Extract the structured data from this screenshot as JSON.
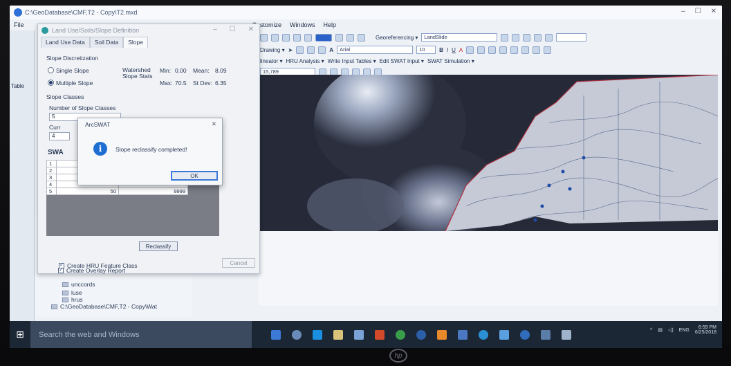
{
  "window": {
    "title": "C:\\GeoDatabase\\CMF,T2 - Copy\\T2.mxd"
  },
  "menubar": {
    "items": [
      "File",
      "Customize",
      "Windows",
      "Help"
    ]
  },
  "toolbar": {
    "georeferencing": "Georeferencing ▾",
    "layer": "LandSlide",
    "drawing": "Drawing ▾",
    "font": "Arial",
    "font_size": "10",
    "swat_items": [
      "lineator ▾",
      "HRU Analysis ▾",
      "Write Input Tables ▾",
      "Edit SWAT Input ▾",
      "SWAT Simulation ▾"
    ],
    "scale": "15,789"
  },
  "dialog": {
    "title": "Land Use/Soils/Slope Definition",
    "tabs": [
      "Land Use Data",
      "Soil Data",
      "Slope"
    ],
    "active_tab": "Slope",
    "slope_discretization": {
      "label": "Slope Discretization",
      "single": "Single Slope",
      "multiple": "Multiple Slope",
      "watershed_stats": "Watershed Slope Stats",
      "min_label": "Min:",
      "min": "0.00",
      "mean_label": "Mean:",
      "mean": "8.09",
      "max_label": "Max:",
      "max": "70.5",
      "stdev_label": "St Dev:",
      "stdev": "6.35"
    },
    "slope_classes": {
      "label": "Slope Classes",
      "number_label": "Number of Slope Classes",
      "number": "5",
      "current_label": "Curr",
      "current": "4",
      "table_label": "SWA",
      "rows": [
        "1",
        "2",
        "3",
        "4",
        "5"
      ],
      "last_row": {
        "lower": "50",
        "upper": "9999"
      }
    },
    "reclassify": "Reclassify",
    "cancel": "Cancel",
    "create_hru": "Create HRU Feature Class",
    "create_overlay": "Create Overlay Report"
  },
  "message_box": {
    "title": "ArcSWAT",
    "text": "Slope reclassify completed!",
    "ok": "OK"
  },
  "catalog": {
    "items": [
      "unccords",
      "luse",
      "hrus"
    ],
    "path": "C:\\GeoDatabase\\CMF,T2 - Copy\\Wat"
  },
  "left_panel": {
    "tab": "Table"
  },
  "taskbar": {
    "search_placeholder": "Search the web and Windows",
    "time": "6:59 PM",
    "date": "6/25/2018",
    "lang": "ENG"
  },
  "colors": {
    "accent": "#2e6fd8",
    "taskbar": "#1c2736"
  }
}
